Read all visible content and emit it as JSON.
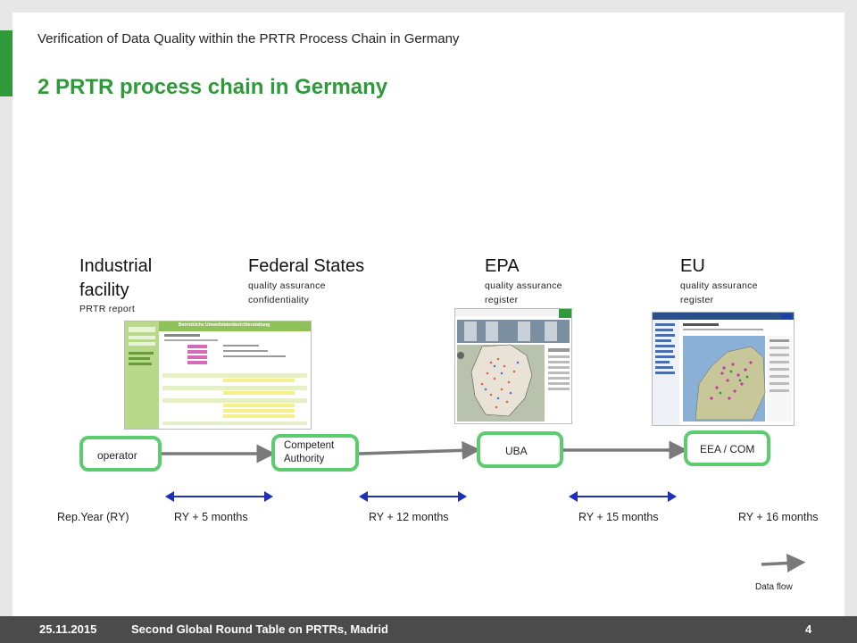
{
  "header": {
    "subtitle": "Verification of Data Quality within the PRTR Process Chain in Germany",
    "title": "2 PRTR process chain in Germany"
  },
  "stages": [
    {
      "title_line1": "Industrial",
      "title_line2": "facility",
      "sub_line1": "PRTR report",
      "sub_line2": ""
    },
    {
      "title_line1": "Federal States",
      "sub_line1": "quality assurance",
      "sub_line2": "confidentiality"
    },
    {
      "title_line1": "EPA",
      "sub_line1": "quality assurance",
      "sub_line2": "register"
    },
    {
      "title_line1": "EU",
      "sub_line1": "quality assurance",
      "sub_line2": "register"
    }
  ],
  "thumbnails": {
    "form_heading": "Betriebliche Umweltdatenberichterstattung"
  },
  "nodes": {
    "operator": "operator",
    "competent_line1": "Competent",
    "competent_line2": "Authority",
    "uba": "UBA",
    "eea": "EEA / COM"
  },
  "timeline": {
    "t0": "Rep.Year (RY)",
    "t1": "RY + 5 months",
    "t2": "RY + 12 months",
    "t3": "RY + 15 months",
    "t4": "RY + 16 months"
  },
  "legend": {
    "data_flow": "Data flow"
  },
  "footer": {
    "date": "25.11.2015",
    "event": "Second Global Round Table on PRTRs, Madrid",
    "page": "4"
  },
  "colors": {
    "accent_green": "#2f9a3a",
    "node_border": "#5ccc6e",
    "flow_arrow": "#7a7a7a",
    "timeline_arrow": "#1f2fb8",
    "footer_bg": "#4b4b4b"
  }
}
